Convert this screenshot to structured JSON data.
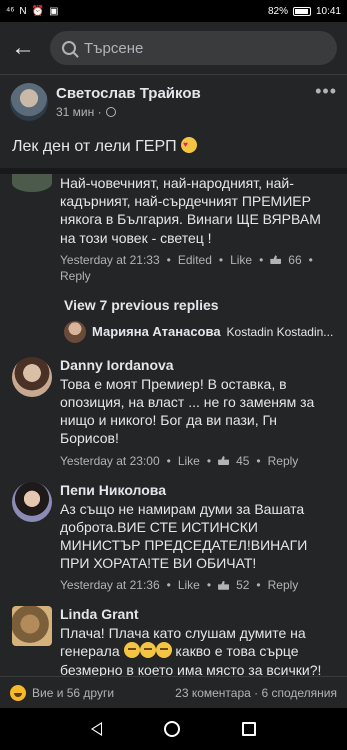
{
  "status_bar": {
    "left_icons": [
      "signal-icon",
      "nfc-icon",
      "alarm-icon",
      "notification-icon"
    ],
    "signal_text": "⁴⁶",
    "battery_percent": "82%",
    "time": "10:41"
  },
  "top_bar": {
    "search_placeholder": "Търсене"
  },
  "post": {
    "author": "Светослав Трайков",
    "time": "31 мин ·",
    "text": "Лек ден от лели ГЕРП",
    "more": "•••"
  },
  "comments": [
    {
      "name": "",
      "text": "Най-човечният, най-народният, най-кадърният, най-сърдечният ПРЕМИЕР някога в България. Винаги ЩЕ ВЯРВАМ на този човек - светец !",
      "time": "Yesterday at 21:33",
      "edited": "Edited",
      "like": "Like",
      "likes": "66",
      "reply": "Reply"
    },
    {
      "name": "Danny Iordanova",
      "text": "Това е моят Премиер! В оставка, в опозиция, на власт ... не го заменям за нищо и никого! Бог да ви пази, Гн Борисов!",
      "time": "Yesterday at 23:00",
      "like": "Like",
      "likes": "45",
      "reply": "Reply"
    },
    {
      "name": "Пепи Николова",
      "text": "Аз също не намирам думи за Вашата доброта.ВИЕ СТЕ ИСТИНСКИ МИНИСТЪР ПРЕДСЕДАТЕЛ!ВИНАГИ ПРИ ХОРАТА!ТЕ ВИ ОБИЧАТ!",
      "time": "Yesterday at 21:36",
      "like": "Like",
      "likes": "52",
      "reply": "Reply"
    },
    {
      "name": "Linda Grant",
      "text_a": "Плача! Плача като слушам думите на генерала",
      "text_b": "какво е това сърце безмерно в което има място за всички?! Как намери сили и за животните да"
    }
  ],
  "view_replies": {
    "label": "View 7 previous replies",
    "preview_name": "Марияна Атанасова",
    "preview_text": "Kostadin Kostadin..."
  },
  "footer": {
    "reactions": "Вие и 56 други",
    "counts": "23 коментара · 6 споделяния"
  }
}
